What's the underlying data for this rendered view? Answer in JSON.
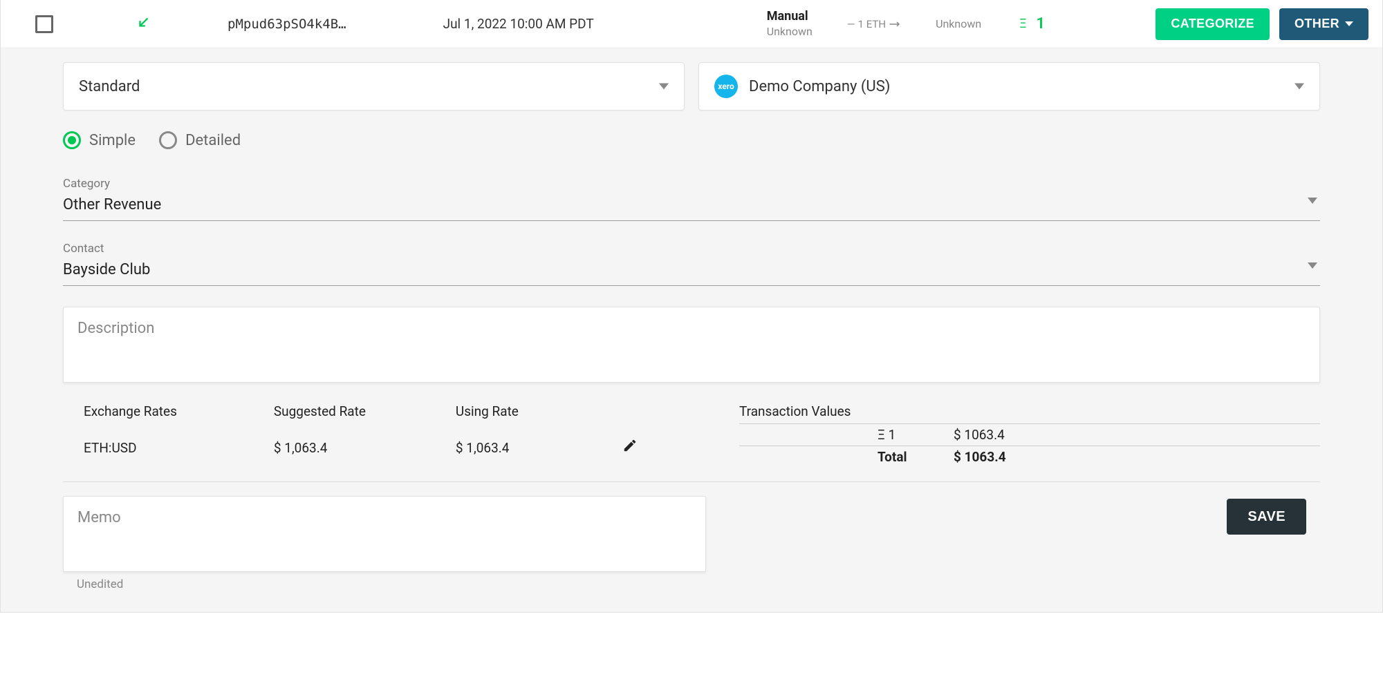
{
  "transaction": {
    "hash": "pMpud63pSO4k4B…",
    "date": "Jul 1, 2022 10:00 AM PDT",
    "source_primary": "Manual",
    "source_secondary": "Unknown",
    "transfer_qty": "1 ETH",
    "counterparty": "Unknown",
    "amount_symbol": "Ξ",
    "amount_value": "1"
  },
  "actions": {
    "categorize": "CATEGORIZE",
    "other": "OTHER",
    "save": "SAVE"
  },
  "selectors": {
    "template": "Standard",
    "company": "Demo Company (US)",
    "company_badge": "xero"
  },
  "view_mode": {
    "simple": "Simple",
    "detailed": "Detailed",
    "selected": "simple"
  },
  "fields": {
    "category_label": "Category",
    "category_value": "Other Revenue",
    "contact_label": "Contact",
    "contact_value": "Bayside Club",
    "description_placeholder": "Description",
    "memo_placeholder": "Memo",
    "unedited": "Unedited"
  },
  "rates": {
    "header_exchange": "Exchange Rates",
    "header_suggested": "Suggested Rate",
    "header_using": "Using Rate",
    "pair": "ETH:USD",
    "suggested": "$ 1,063.4",
    "using": "$ 1,063.4"
  },
  "txvalues": {
    "title": "Transaction Values",
    "line_symbol": "Ξ 1",
    "line_value": "$ 1063.4",
    "total_label": "Total",
    "total_value": "$ 1063.4"
  }
}
